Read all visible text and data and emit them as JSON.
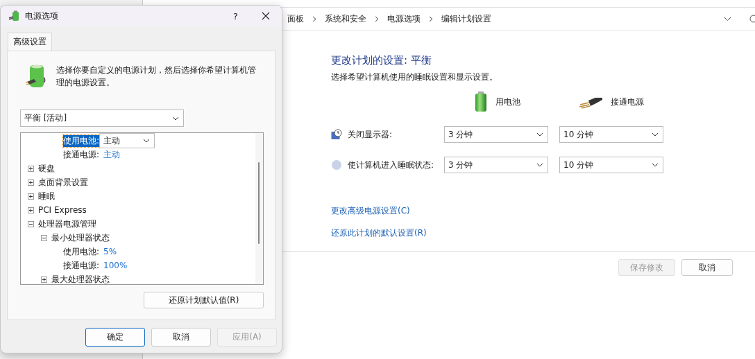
{
  "background_window": {
    "breadcrumb": [
      "面板",
      "系统和安全",
      "电源选项",
      "编辑计划设置"
    ],
    "plan_title": "更改计划的设置: 平衡",
    "subtitle": "选择希望计算机使用的睡眠设置和显示设置。",
    "columns": [
      {
        "kind": "battery",
        "label": "用电池"
      },
      {
        "kind": "plugged",
        "label": "接通电源"
      }
    ],
    "settings": [
      {
        "kind": "display",
        "label": "关闭显示器:",
        "battery": "3 分钟",
        "plugged": "10 分钟"
      },
      {
        "kind": "sleep",
        "label": "使计算机进入睡眠状态:",
        "battery": "3 分钟",
        "plugged": "10 分钟"
      }
    ],
    "links": [
      "更改高级电源设置(C)",
      "还原此计划的默认设置(R)"
    ],
    "buttons": [
      {
        "label": "保存修改",
        "disabled": true
      },
      {
        "label": "取消",
        "disabled": false
      }
    ]
  },
  "dialog": {
    "title": "电源选项",
    "help": "?",
    "tabs": [
      {
        "label": "高级设置",
        "selected": true
      }
    ],
    "description": "选择你要自定义的电源计划，然后选择你希望计算机管理的电源设置。",
    "plan_select": {
      "value": "平衡 [活动]"
    },
    "tree": {
      "scrolled_rows": [
        {
          "label": "使用电池:",
          "value": "主动",
          "editing": true
        },
        {
          "label": "接通电源:",
          "value": "主动",
          "editing": false
        }
      ],
      "items": [
        {
          "kind": "group",
          "label": "硬盘",
          "expanded": false
        },
        {
          "kind": "group",
          "label": "桌面背景设置",
          "expanded": false
        },
        {
          "kind": "group",
          "label": "睡眠",
          "expanded": false
        },
        {
          "kind": "group",
          "label": "PCI Express",
          "expanded": false
        },
        {
          "kind": "group",
          "label": "处理器电源管理",
          "expanded": true,
          "children": [
            {
              "kind": "group",
              "label": "最小处理器状态",
              "expanded": true,
              "children": [
                {
                  "kind": "setting",
                  "label": "使用电池:",
                  "value": "5%"
                },
                {
                  "kind": "setting",
                  "label": "接通电源:",
                  "value": "100%"
                }
              ]
            },
            {
              "kind": "group",
              "label": "最大处理器状态",
              "expanded": false
            }
          ]
        }
      ]
    },
    "restore_button": "还原计划默认值(R)",
    "buttons": [
      {
        "label": "确定",
        "default": true,
        "disabled": false
      },
      {
        "label": "取消",
        "default": false,
        "disabled": false
      },
      {
        "label": "应用(A)",
        "default": false,
        "disabled": true
      }
    ]
  }
}
